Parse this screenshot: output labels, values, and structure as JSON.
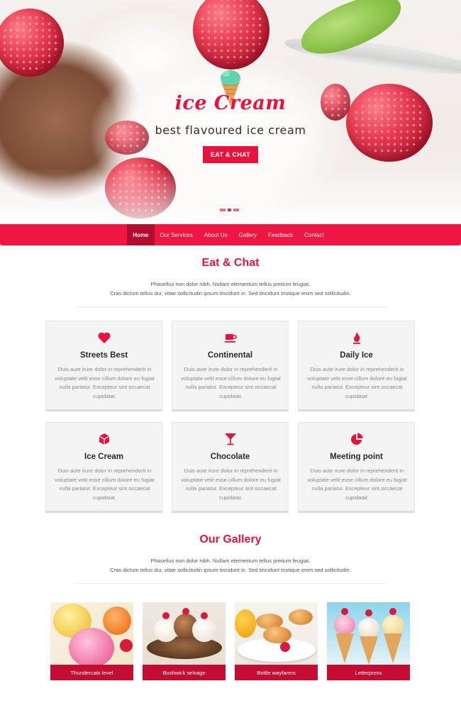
{
  "hero": {
    "title": "ice Cream",
    "subtitle": "best flavoured ice cream",
    "button_label": "EAT & CHAT",
    "slides": 3,
    "active_slide": 2
  },
  "nav": {
    "items": [
      {
        "label": "Home",
        "active": true
      },
      {
        "label": "Our Services",
        "active": false
      },
      {
        "label": "About Us",
        "active": false
      },
      {
        "label": "Gallery",
        "active": false
      },
      {
        "label": "Feedback",
        "active": false
      },
      {
        "label": "Contact",
        "active": false
      }
    ]
  },
  "eat_chat": {
    "title": "Eat & Chat",
    "desc_line1": "Phasellus non dolor nibh. Nullam elementum tellus pretium feugiat.",
    "desc_line2": "Cras dictum tellus dui, vitae sollicitudin ipsum tincidunt in. Sed tincidunt tristique enim sed sollicitudin."
  },
  "cards": [
    {
      "title": "Streets Best",
      "icon": "heart-icon",
      "text": "Duis aute irure dolor in reprehenderit in voluptate velit esse cillum dolore eu fugiat nulla pariatur. Excepteur sint occaecat cupidatat."
    },
    {
      "title": "Continental",
      "icon": "coffee-cup-icon",
      "text": "Duis aute irure dolor in reprehenderit in voluptate velit esse cillum dolore eu fugiat nulla pariatur. Excepteur sint occaecat cupidatat."
    },
    {
      "title": "Daily Ice",
      "icon": "flame-icon",
      "text": "Duis aute irure dolor in reprehenderit in voluptate velit esse cillum dolore eu fugiat nulla pariatur. Excepteur sint occaecat cupidatat."
    },
    {
      "title": "Ice Cream",
      "icon": "cube-icon",
      "text": "Duis aute irure dolor in reprehenderit in voluptate velit esse cillum dolore eu fugiat nulla pariatur. Excepteur sint occaecat cupidatat."
    },
    {
      "title": "Chocolate",
      "icon": "cocktail-glass-icon",
      "text": "Duis aute irure dolor in reprehenderit in voluptate velit esse cillum dolore eu fugiat nulla pariatur. Excepteur sint occaecat cupidatat."
    },
    {
      "title": "Meeting point",
      "icon": "pie-chart-icon",
      "text": "Duis aute irure dolor in reprehenderit in voluptate velit esse cillum dolore eu fugiat nulla pariatur. Excepteur sint occaecat cupidatat."
    }
  ],
  "gallery": {
    "title": "Our Gallery",
    "desc_line1": "Phasellus non dolor nibh. Nullam elementum tellus pretium feugiat.",
    "desc_line2": "Cras dictum tellus dui, vitae sollicitudin ipsum tincidunt in. Sed tincidunt tristique enim sed sollicitudin.",
    "items": [
      {
        "caption": "Thundercats level"
      },
      {
        "caption": "Bushwick selvage"
      },
      {
        "caption": "Bottle wayfarers"
      },
      {
        "caption": "Letterpress"
      }
    ]
  },
  "colors": {
    "accent": "#e8123d",
    "nav_bg": "#ee1744",
    "nav_active": "#b30c2f",
    "caption_bg": "#c50d33",
    "card_bg": "#f4f4f4"
  }
}
